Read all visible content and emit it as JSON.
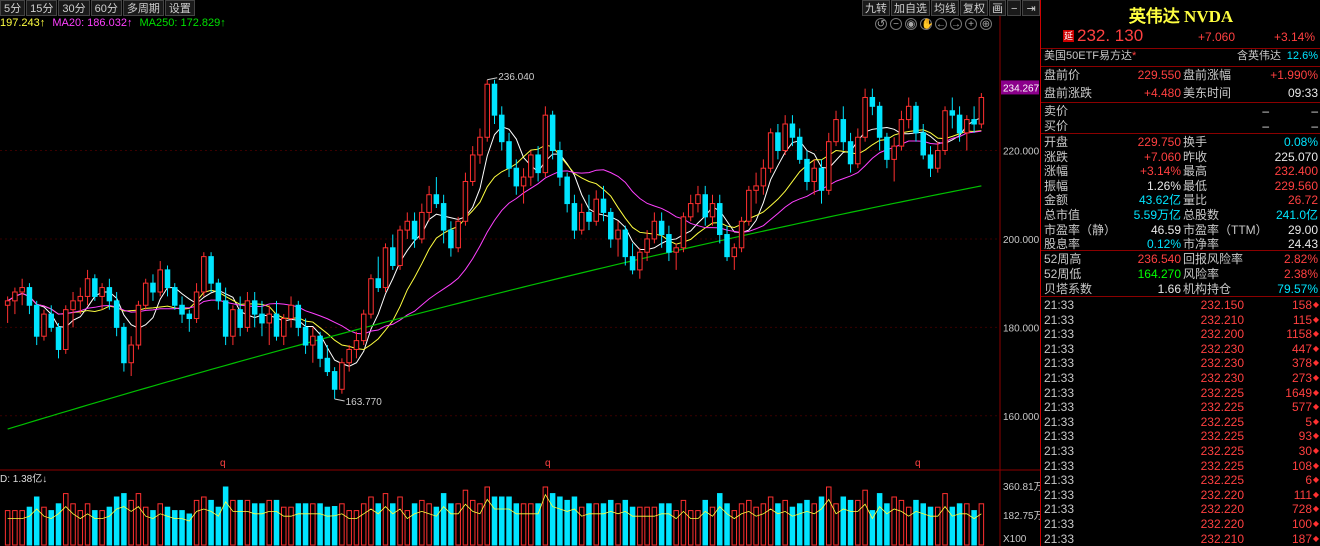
{
  "toolbar": {
    "periods": [
      "5分",
      "15分",
      "30分",
      "60分",
      "多周期",
      "设置"
    ],
    "right_tools": [
      "九转",
      "加自选",
      "均线",
      "复权",
      "画"
    ]
  },
  "ma_legend": {
    "ma5": "197.243↑",
    "ma20": "MA20: 186.032↑",
    "ma250": "MA250: 172.829↑"
  },
  "chart_data": {
    "type": "candlestick",
    "y_ticks": [
      "220.000",
      "200.000",
      "180.000",
      "160.000"
    ],
    "ylim": [
      150,
      245
    ],
    "current_price_label": "234.267",
    "annotations": {
      "high": "236.040",
      "low": "163.770"
    },
    "divider_marks": [
      "q",
      "q",
      "q"
    ],
    "volume_label": "D: 1.38亿↓",
    "volume_ticks": [
      "360.81万",
      "182.75万",
      "X100"
    ],
    "colors": {
      "up": "#ff3030",
      "down": "#00e5ff",
      "ma5": "#ffffff",
      "ma10": "#ffff40",
      "ma20": "#ff40ff",
      "ma250": "#00c000"
    },
    "candles": [
      [
        185,
        187,
        181,
        186
      ],
      [
        186,
        189,
        183,
        188
      ],
      [
        188,
        191,
        185,
        189
      ],
      [
        189,
        190,
        183,
        185
      ],
      [
        185,
        186,
        176,
        178
      ],
      [
        178,
        184,
        177,
        183
      ],
      [
        183,
        185,
        179,
        180
      ],
      [
        180,
        181,
        173,
        175
      ],
      [
        175,
        185,
        174,
        184
      ],
      [
        184,
        188,
        180,
        186
      ],
      [
        186,
        189,
        183,
        187
      ],
      [
        187,
        193,
        185,
        191
      ],
      [
        191,
        192,
        186,
        187
      ],
      [
        187,
        190,
        184,
        189
      ],
      [
        189,
        191,
        184,
        186
      ],
      [
        186,
        188,
        178,
        180
      ],
      [
        180,
        181,
        170,
        172
      ],
      [
        172,
        178,
        169,
        176
      ],
      [
        176,
        186,
        175,
        185
      ],
      [
        185,
        191,
        184,
        190
      ],
      [
        190,
        192,
        186,
        188
      ],
      [
        188,
        195,
        187,
        193
      ],
      [
        193,
        194,
        187,
        189
      ],
      [
        189,
        190,
        184,
        185
      ],
      [
        185,
        187,
        181,
        183
      ],
      [
        183,
        184,
        179,
        182
      ],
      [
        182,
        190,
        181,
        188
      ],
      [
        188,
        197,
        187,
        196
      ],
      [
        196,
        197,
        188,
        190
      ],
      [
        190,
        191,
        184,
        186
      ],
      [
        186,
        189,
        176,
        178
      ],
      [
        178,
        185,
        176,
        184
      ],
      [
        184,
        187,
        178,
        180
      ],
      [
        180,
        188,
        179,
        186
      ],
      [
        186,
        188,
        180,
        183
      ],
      [
        183,
        186,
        178,
        181
      ],
      [
        181,
        185,
        176,
        183
      ],
      [
        183,
        186,
        177,
        178
      ],
      [
        178,
        183,
        176,
        182
      ],
      [
        182,
        187,
        180,
        185
      ],
      [
        185,
        186,
        178,
        180
      ],
      [
        180,
        182,
        174,
        176
      ],
      [
        176,
        180,
        172,
        178
      ],
      [
        178,
        179,
        171,
        173
      ],
      [
        173,
        176,
        169,
        170
      ],
      [
        170,
        171,
        163.8,
        166
      ],
      [
        166,
        173,
        165,
        172
      ],
      [
        172,
        176,
        170,
        175
      ],
      [
        175,
        179,
        173,
        177
      ],
      [
        177,
        184,
        176,
        183
      ],
      [
        183,
        192,
        182,
        191
      ],
      [
        191,
        196,
        188,
        189
      ],
      [
        189,
        199,
        188,
        198
      ],
      [
        198,
        201,
        193,
        194
      ],
      [
        194,
        203,
        193,
        202
      ],
      [
        202,
        206,
        200,
        204
      ],
      [
        204,
        206,
        198,
        200
      ],
      [
        200,
        208,
        199,
        206
      ],
      [
        206,
        212,
        204,
        210
      ],
      [
        210,
        214,
        207,
        208
      ],
      [
        208,
        210,
        199,
        202
      ],
      [
        202,
        204,
        196,
        198
      ],
      [
        198,
        205,
        197,
        204
      ],
      [
        204,
        215,
        203,
        213
      ],
      [
        213,
        221,
        212,
        219
      ],
      [
        219,
        225,
        217,
        223
      ],
      [
        223,
        236,
        222,
        235
      ],
      [
        235,
        236,
        226,
        228
      ],
      [
        228,
        230,
        220,
        222
      ],
      [
        222,
        224,
        214,
        216
      ],
      [
        216,
        218,
        210,
        212
      ],
      [
        212,
        216,
        208,
        214
      ],
      [
        214,
        220,
        212,
        219
      ],
      [
        219,
        221,
        213,
        215
      ],
      [
        215,
        230,
        214,
        228
      ],
      [
        228,
        229,
        218,
        220
      ],
      [
        220,
        222,
        212,
        214
      ],
      [
        214,
        215,
        206,
        208
      ],
      [
        208,
        210,
        200,
        202
      ],
      [
        202,
        208,
        201,
        206
      ],
      [
        206,
        210,
        202,
        204
      ],
      [
        204,
        211,
        203,
        209
      ],
      [
        209,
        212,
        204,
        206
      ],
      [
        206,
        207,
        198,
        200
      ],
      [
        200,
        204,
        196,
        202
      ],
      [
        202,
        203,
        194,
        196
      ],
      [
        196,
        199,
        192,
        193
      ],
      [
        193,
        198,
        191,
        197
      ],
      [
        197,
        202,
        195,
        200
      ],
      [
        200,
        206,
        199,
        204
      ],
      [
        204,
        206,
        198,
        201
      ],
      [
        201,
        203,
        195,
        197
      ],
      [
        197,
        199,
        193,
        198
      ],
      [
        198,
        206,
        197,
        205
      ],
      [
        205,
        210,
        204,
        208
      ],
      [
        208,
        212,
        206,
        210
      ],
      [
        210,
        212,
        203,
        205
      ],
      [
        205,
        210,
        203,
        208
      ],
      [
        208,
        210,
        199,
        201
      ],
      [
        201,
        203,
        195,
        196
      ],
      [
        196,
        199,
        193,
        198
      ],
      [
        198,
        205,
        197,
        204
      ],
      [
        204,
        212,
        203,
        211
      ],
      [
        211,
        215,
        208,
        212
      ],
      [
        212,
        218,
        210,
        216
      ],
      [
        216,
        225,
        215,
        224
      ],
      [
        224,
        226,
        218,
        220
      ],
      [
        220,
        228,
        219,
        226
      ],
      [
        226,
        228,
        221,
        223
      ],
      [
        223,
        225,
        217,
        218
      ],
      [
        218,
        220,
        211,
        213
      ],
      [
        213,
        218,
        210,
        216
      ],
      [
        216,
        218,
        208,
        211
      ],
      [
        211,
        224,
        210,
        222
      ],
      [
        222,
        229,
        221,
        227
      ],
      [
        227,
        230,
        220,
        222
      ],
      [
        222,
        224,
        215,
        217
      ],
      [
        217,
        225,
        216,
        223
      ],
      [
        223,
        234,
        222,
        232
      ],
      [
        232,
        234,
        228,
        230
      ],
      [
        230,
        231,
        220,
        223
      ],
      [
        223,
        224,
        216,
        218
      ],
      [
        218,
        223,
        213,
        221
      ],
      [
        221,
        229,
        220,
        227
      ],
      [
        227,
        232,
        225,
        230
      ],
      [
        230,
        231,
        222,
        224
      ],
      [
        224,
        226,
        218,
        219
      ],
      [
        219,
        221,
        214,
        216
      ],
      [
        216,
        222,
        215,
        220
      ],
      [
        220,
        230,
        219,
        229
      ],
      [
        229,
        232,
        225,
        228
      ],
      [
        228,
        230,
        222,
        224
      ],
      [
        224,
        228,
        220,
        227
      ],
      [
        227,
        230,
        224,
        226
      ],
      [
        226,
        233,
        225,
        232
      ]
    ]
  },
  "stock": {
    "name": "英伟达 NVDA",
    "badge": "延",
    "price": "232. 130",
    "change": "+7.060",
    "change_pct": "+3.14%"
  },
  "etf": {
    "left": "美国50ETF易方达",
    "star": "*",
    "right_label": "含英伟达",
    "right_value": "12.6%"
  },
  "premarket": [
    {
      "l": "盘前价",
      "v": "229.550",
      "vc": "red",
      "l2": "盘前涨幅",
      "v2": "+1.990%",
      "v2c": "red"
    },
    {
      "l": "盘前涨跌",
      "v": "+4.480",
      "vc": "red",
      "l2": "美东时间",
      "v2": "09:33",
      "v2c": "white"
    }
  ],
  "orderbook": [
    {
      "l": "卖价",
      "v": "–"
    },
    {
      "l": "买价",
      "v": "–"
    }
  ],
  "stats": [
    {
      "l": "开盘",
      "v": "229.750",
      "vc": "red",
      "l2": "换手",
      "v2": "0.08%",
      "v2c": "cyan"
    },
    {
      "l": "涨跌",
      "v": "+7.060",
      "vc": "red",
      "l2": "昨收",
      "v2": "225.070",
      "v2c": "white"
    },
    {
      "l": "涨幅",
      "v": "+3.14%",
      "vc": "red",
      "l2": "最高",
      "v2": "232.400",
      "v2c": "red"
    },
    {
      "l": "振幅",
      "v": "1.26%",
      "vc": "white",
      "l2": "最低",
      "v2": "229.560",
      "v2c": "red"
    },
    {
      "l": "金额",
      "v": "43.62亿",
      "vc": "cyan",
      "l2": "量比",
      "v2": "26.72",
      "v2c": "red"
    },
    {
      "l": "总市值",
      "v": "5.59万亿",
      "vc": "cyan",
      "l2": "总股数",
      "v2": "241.0亿",
      "v2c": "cyan"
    },
    {
      "l": "市盈率（静）",
      "v": "46.59",
      "vc": "white",
      "l2": "市盈率（TTM）",
      "v2": "29.00",
      "v2c": "white"
    },
    {
      "l": "股息率",
      "v": "0.12%",
      "vc": "cyan",
      "l2": "市净率",
      "v2": "24.43",
      "v2c": "white"
    }
  ],
  "stats2": [
    {
      "l": "52周高",
      "v": "236.540",
      "vc": "red",
      "l2": "回报风险率",
      "v2": "2.82%",
      "v2c": "red"
    },
    {
      "l": "52周低",
      "v": "164.270",
      "vc": "green",
      "l2": "风险率",
      "v2": "2.38%",
      "v2c": "red"
    },
    {
      "l": "贝塔系数",
      "v": "1.66",
      "vc": "white",
      "l2": "机构持仓",
      "v2": "79.57%",
      "v2c": "cyan"
    }
  ],
  "ticks": [
    {
      "t": "21:33",
      "p": "232.150",
      "q": "158"
    },
    {
      "t": "21:33",
      "p": "232.210",
      "q": "115"
    },
    {
      "t": "21:33",
      "p": "232.200",
      "q": "1158"
    },
    {
      "t": "21:33",
      "p": "232.230",
      "q": "447"
    },
    {
      "t": "21:33",
      "p": "232.230",
      "q": "378"
    },
    {
      "t": "21:33",
      "p": "232.230",
      "q": "273"
    },
    {
      "t": "21:33",
      "p": "232.225",
      "q": "1649"
    },
    {
      "t": "21:33",
      "p": "232.225",
      "q": "577"
    },
    {
      "t": "21:33",
      "p": "232.225",
      "q": "5"
    },
    {
      "t": "21:33",
      "p": "232.225",
      "q": "93"
    },
    {
      "t": "21:33",
      "p": "232.225",
      "q": "30"
    },
    {
      "t": "21:33",
      "p": "232.225",
      "q": "108"
    },
    {
      "t": "21:33",
      "p": "232.225",
      "q": "6"
    },
    {
      "t": "21:33",
      "p": "232.220",
      "q": "111"
    },
    {
      "t": "21:33",
      "p": "232.220",
      "q": "728"
    },
    {
      "t": "21:33",
      "p": "232.220",
      "q": "100"
    },
    {
      "t": "21:33",
      "p": "232.210",
      "q": "187"
    }
  ]
}
